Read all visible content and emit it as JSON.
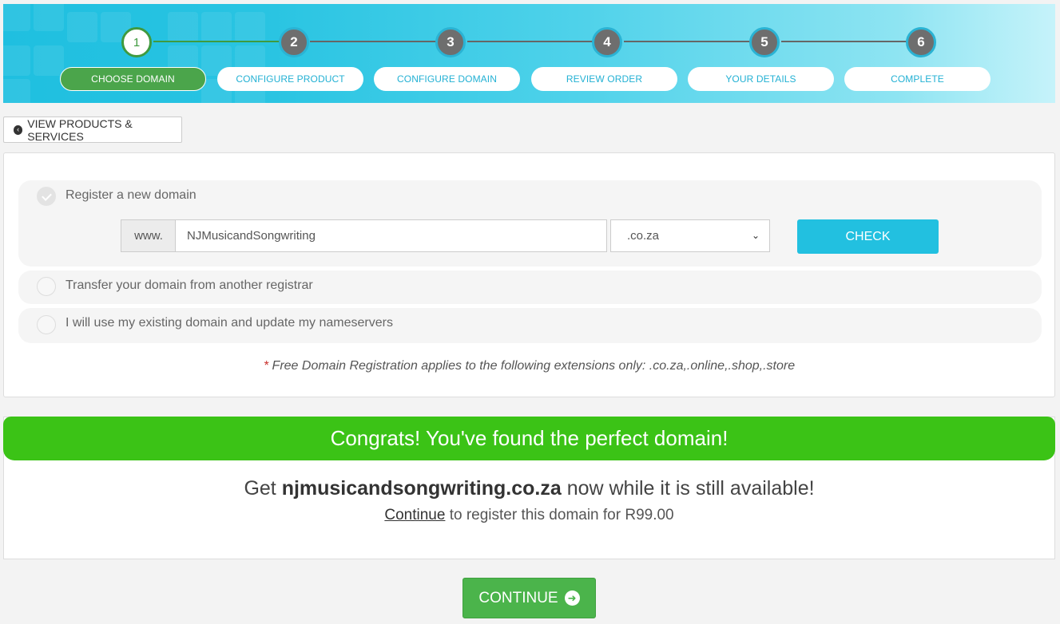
{
  "stepper": {
    "steps": [
      {
        "number": "1",
        "label": "CHOOSE DOMAIN",
        "active": true
      },
      {
        "number": "2",
        "label": "CONFIGURE PRODUCT",
        "active": false
      },
      {
        "number": "3",
        "label": "CONFIGURE DOMAIN",
        "active": false
      },
      {
        "number": "4",
        "label": "REVIEW ORDER",
        "active": false
      },
      {
        "number": "5",
        "label": "YOUR DETAILS",
        "active": false
      },
      {
        "number": "6",
        "label": "COMPLETE",
        "active": false
      }
    ]
  },
  "view_products": {
    "label": "VIEW PRODUCTS & SERVICES",
    "icon": "chevron-left-circle-icon"
  },
  "domain_options": {
    "register": {
      "label": "Register a new domain",
      "selected": true
    },
    "www_prefix": "www.",
    "domain_value": "NJMusicandSongwriting",
    "tld_selected": ".co.za",
    "check_label": "CHECK",
    "transfer": {
      "label": "Transfer your domain from another registrar",
      "selected": false
    },
    "existing": {
      "label": "I will use my existing domain and update my nameservers",
      "selected": false
    },
    "free_note_star": "*",
    "free_note": "Free Domain Registration applies to the following extensions only: .co.za,.online,.shop,.store"
  },
  "congrats": {
    "heading": "Congrats! You've found the perfect domain!",
    "get_prefix": "Get",
    "domain": "njmusicandsongwriting.co.za",
    "get_suffix": "now while it is still available!",
    "continue_link": "Continue",
    "register_text": "to register this domain for R99.00"
  },
  "continue_button": {
    "label": "CONTINUE",
    "icon": "arrow-right-circle-icon"
  },
  "colors": {
    "accent_blue": "#22c0e0",
    "accent_green": "#3bc316",
    "step_active": "#4ba54b"
  }
}
